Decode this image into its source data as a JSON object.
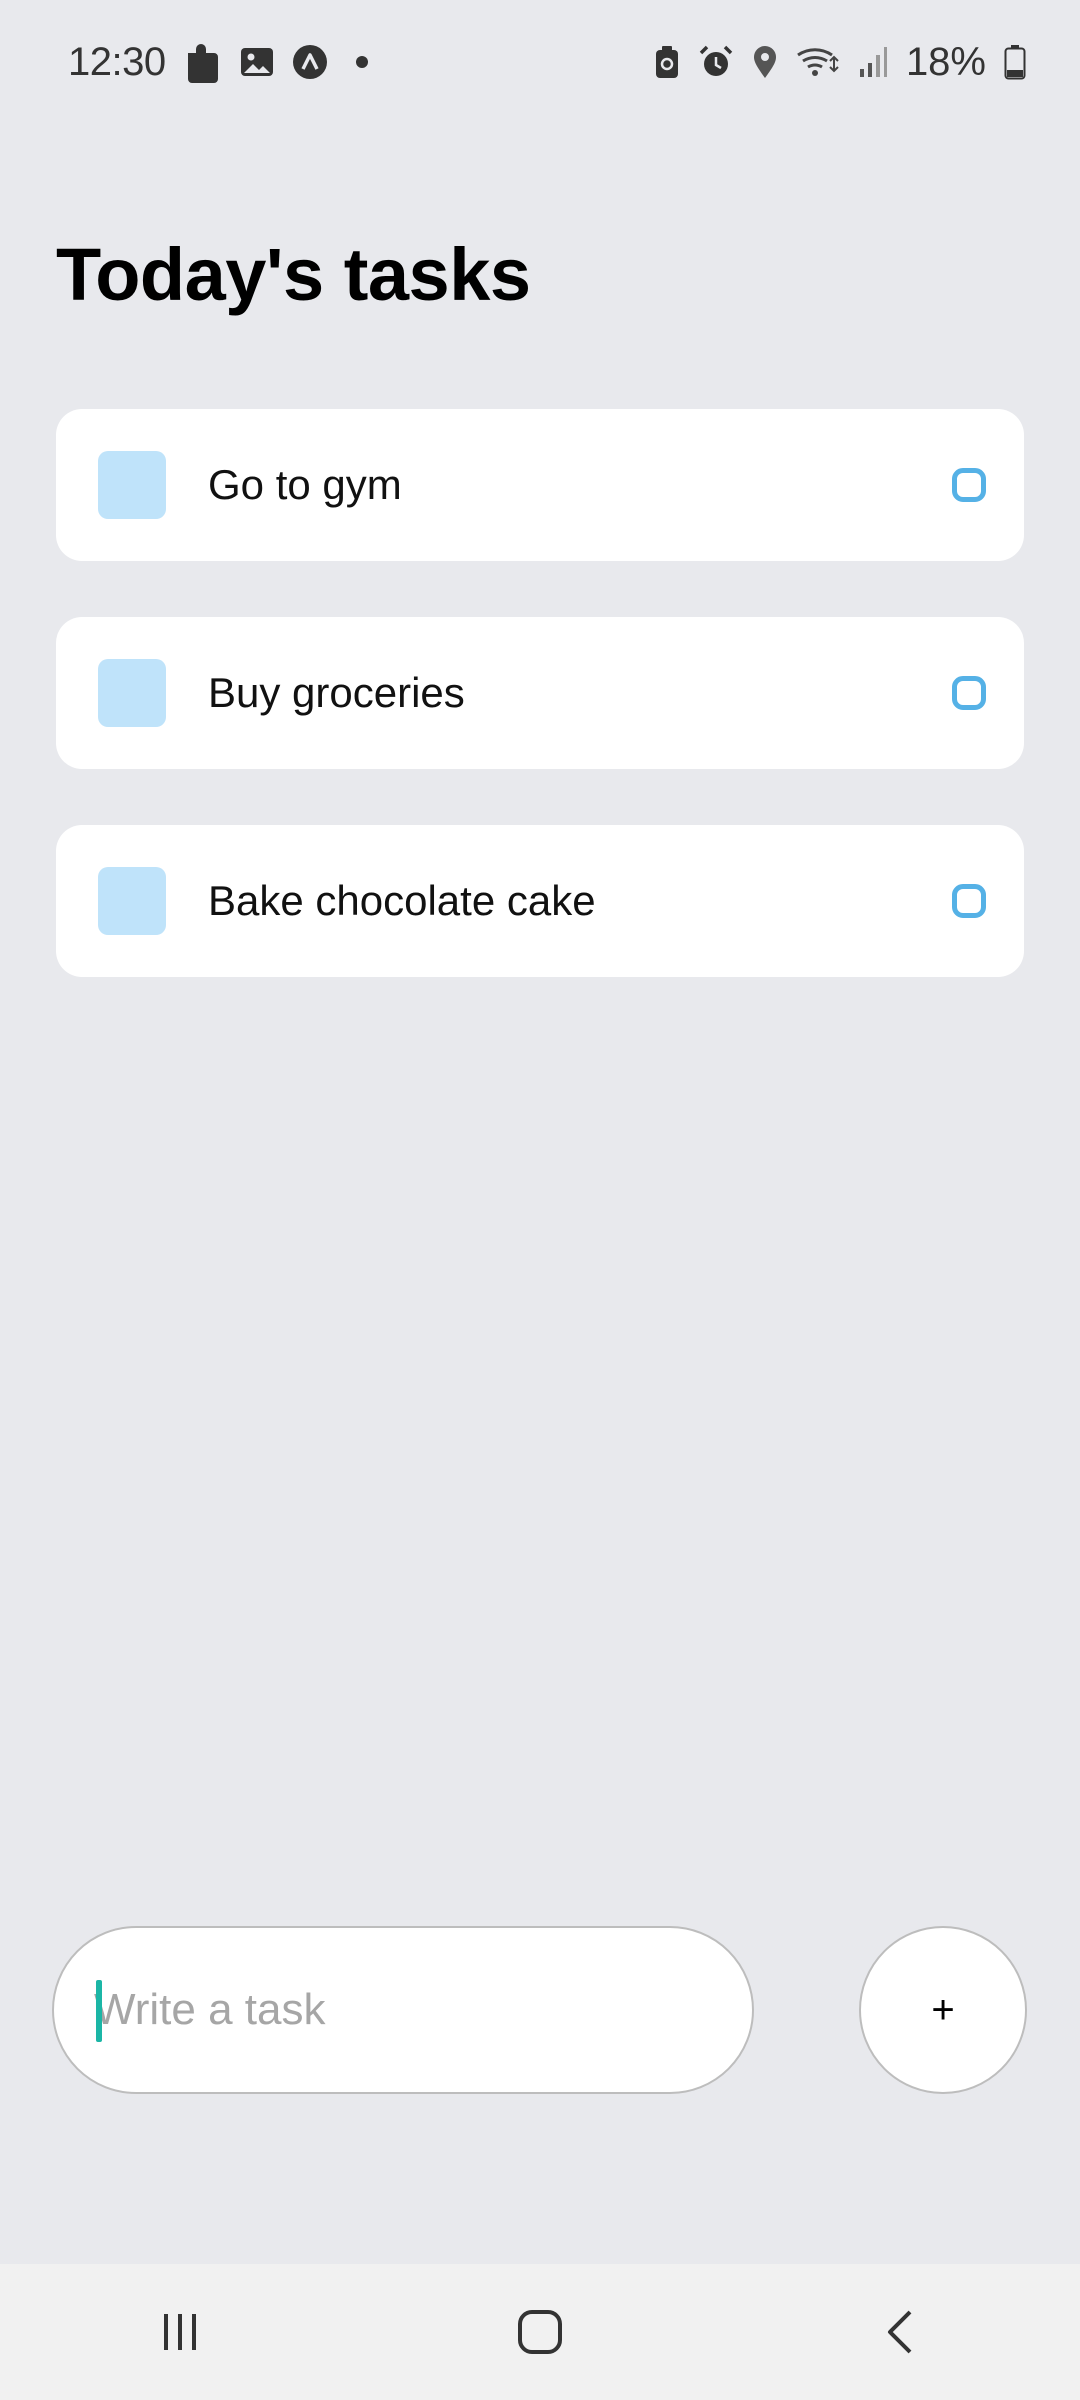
{
  "status_bar": {
    "time": "12:30",
    "battery": "18%",
    "left_icons": [
      "puzzle-icon",
      "image-icon",
      "app-a-icon",
      "dot-icon"
    ],
    "right_icons": [
      "battery-saver-icon",
      "alarm-icon",
      "location-icon",
      "wifi-icon",
      "signal-icon",
      "battery-icon"
    ]
  },
  "page": {
    "title": "Today's tasks"
  },
  "tasks": [
    {
      "label": "Go to gym"
    },
    {
      "label": "Buy groceries"
    },
    {
      "label": "Bake chocolate cake"
    }
  ],
  "composer": {
    "placeholder": "Write a task",
    "value": "",
    "add_label": "+"
  },
  "colors": {
    "background": "#e8e9ed",
    "card": "#ffffff",
    "task_square": "#bfe3fa",
    "task_circle": "#55b1e6",
    "caret": "#1bb6a6"
  },
  "nav_bar": {
    "buttons": [
      "recent-apps-icon",
      "home-icon",
      "back-icon"
    ]
  }
}
